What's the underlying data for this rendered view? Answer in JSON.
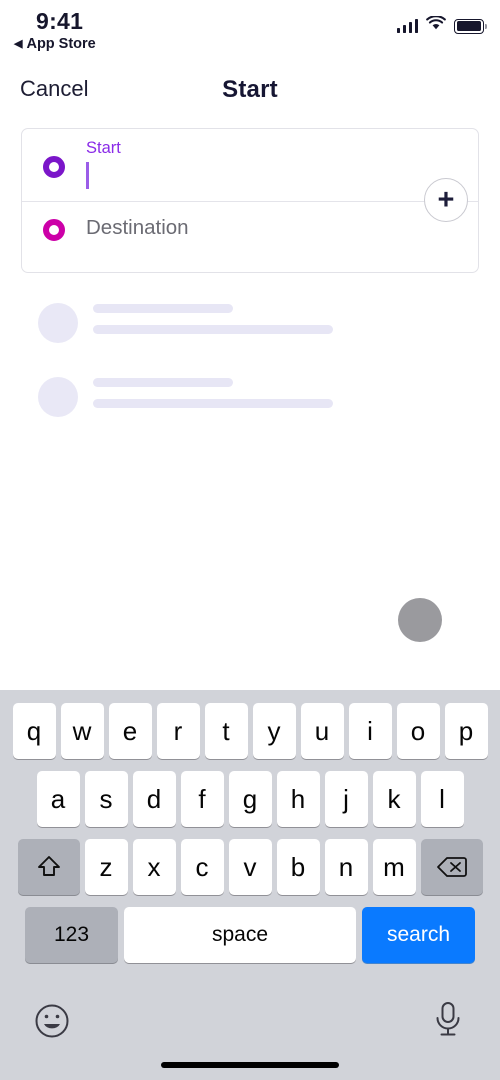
{
  "status_bar": {
    "time": "9:41",
    "back_label": "App Store",
    "back_triangle": "◀",
    "signal_icon": "cellular-signal-icon",
    "wifi_icon": "wifi-icon",
    "battery_icon": "battery-full-icon"
  },
  "nav": {
    "cancel_label": "Cancel",
    "title": "Start"
  },
  "route_card": {
    "start": {
      "label": "Start",
      "value": "",
      "pin_icon": "start-pin-icon",
      "pin_color": "#7b16c9",
      "label_color": "#8a2be8",
      "focused": true
    },
    "destination": {
      "placeholder": "Destination",
      "value": "",
      "pin_icon": "destination-pin-icon",
      "pin_color": "#cc00a8",
      "placeholder_color": "#6b6b73"
    },
    "add_button": {
      "glyph": "+",
      "icon": "plus-icon"
    }
  },
  "results": {
    "loading": true,
    "placeholder_rows": [
      {
        "avatar_icon": "avatar-placeholder-icon"
      },
      {
        "avatar_icon": "avatar-placeholder-icon"
      }
    ],
    "skeleton_color": "#e7e6f5"
  },
  "map_control": {
    "icon": "map-locate-button-icon",
    "color": "#9a9a9e"
  },
  "keyboard": {
    "type": "qwerty-lowercase",
    "background_color": "#d1d3d9",
    "row1": [
      "q",
      "w",
      "e",
      "r",
      "t",
      "y",
      "u",
      "i",
      "o",
      "p"
    ],
    "row2": [
      "a",
      "s",
      "d",
      "f",
      "g",
      "h",
      "j",
      "k",
      "l"
    ],
    "row3_letters": [
      "z",
      "x",
      "c",
      "v",
      "b",
      "n",
      "m"
    ],
    "shift_icon": "shift-arrow-icon",
    "backspace_icon": "backspace-delete-icon",
    "numbers_label": "123",
    "space_label": "space",
    "search_label": "search",
    "search_key_color": "#0a7aff",
    "emoji_icon": "emoji-smiley-icon",
    "microphone_icon": "microphone-icon"
  },
  "home_indicator": {
    "icon": "home-indicator-bar"
  }
}
